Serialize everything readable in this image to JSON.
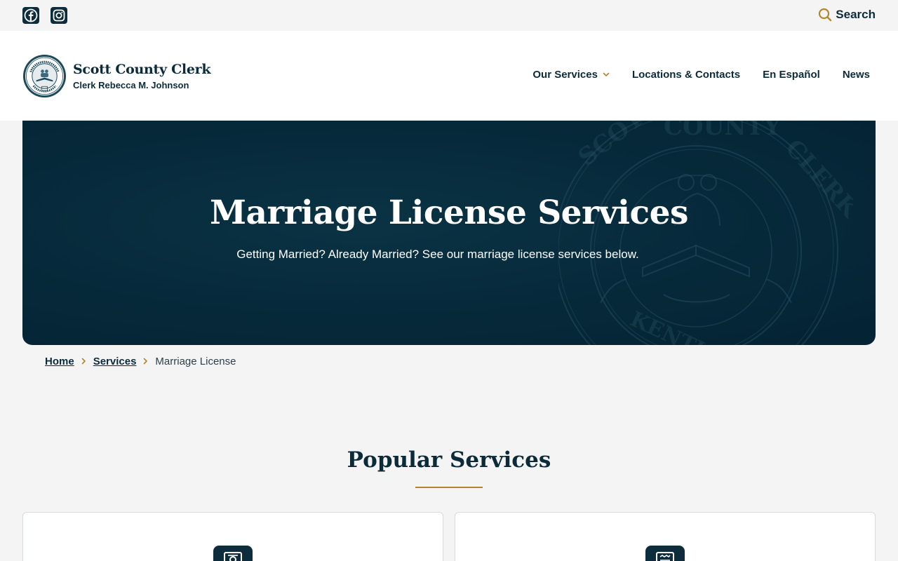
{
  "topbar": {
    "social": [
      {
        "icon": "facebook-icon"
      },
      {
        "icon": "instagram-icon"
      }
    ],
    "search_label": "Search"
  },
  "brand": {
    "title": "Scott County Clerk",
    "subtitle": "Clerk Rebecca M. Johnson"
  },
  "nav": {
    "items": [
      {
        "label": "Our Services",
        "has_dropdown": true
      },
      {
        "label": "Locations & Contacts"
      },
      {
        "label": "En Español"
      },
      {
        "label": "News"
      }
    ]
  },
  "hero": {
    "title": "Marriage License Services",
    "subtitle": "Getting Married? Already Married? See our marriage license services below."
  },
  "breadcrumb": {
    "items": [
      {
        "label": "Home",
        "link": true
      },
      {
        "label": "Services",
        "link": true
      },
      {
        "label": "Marriage License",
        "link": false
      }
    ]
  },
  "popular": {
    "title": "Popular Services",
    "cards": [
      {
        "icon": "certificate-icon"
      },
      {
        "icon": "document-icon"
      }
    ]
  },
  "colors": {
    "navy": "#0c2b3a",
    "hero_bg": "#06293a",
    "gold": "#b4862b",
    "page_bg": "#f4f4f4"
  }
}
